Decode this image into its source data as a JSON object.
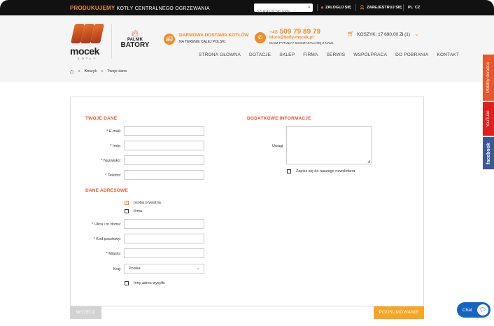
{
  "topbar": {
    "promo_highlight": "PRODUKUJEMY",
    "promo_text": "KOTŁY CENTRALNEGO OGRZEWANIA",
    "search_placeholder": "SZUKAJ W SKLEPIE...",
    "login": "ZALOGUJ SIĘ",
    "register": "ZAREJESTRUJ SIĘ",
    "lang_pl": "PL",
    "lang_cz": "CZ"
  },
  "header": {
    "logo_name": "mocek",
    "logo_sub": "KOTŁY",
    "partner_small": "PALNIK",
    "partner_big": "BATORY",
    "delivery_title": "DARMOWA DOSTAWA KOTŁÓW",
    "delivery_sub": "NA TERENIE CAŁEJ POLSKI.",
    "phone_prefix": "+48",
    "phone": "509 79 89 79",
    "email": "biuro@kotly-mocek.pl",
    "ask": "MASZ PYTANIA? SKONTAKTUJ SIĘ Z NAMI.",
    "cart": "KOSZYK: 17 690,00 Zł (1)"
  },
  "nav": [
    "STRONA GŁÓWNA",
    "DOTACJE",
    "SKLEP",
    "FIRMA",
    "SERWIS",
    "WSPÓŁPRACA",
    "DO POBRANIA",
    "KONTAKT"
  ],
  "breadcrumb": {
    "sep": "»",
    "items": [
      "Koszyk",
      "Twoje dane"
    ]
  },
  "form": {
    "your_data_title": "TWOJE DANE",
    "email_label": "* E-mail:",
    "name_label": "* Imię:",
    "surname_label": "* Nazwisko:",
    "phone_label": "* Telefon:",
    "address_title": "DANE ADRESOWE",
    "private_label": "osoba prywatna",
    "company_label": "firma",
    "street_label": "* Ulica i nr domu:",
    "zip_label": "* Kod pocztowy:",
    "city_label": "* Miasto:",
    "country_label": "Kraj:",
    "country_value": "Polska",
    "other_address_label": "Inny adres wysyłki",
    "extra_title": "DODATKOWE INFORMACJE",
    "notes_label": "Uwagi",
    "newsletter_label": "Zapisz się do naszego newslettera",
    "back_button": "WSTECZ",
    "next_button": "PODSUMOWANIE"
  },
  "side": {
    "mobile": "Mobilny doradca",
    "youtube": "YouTube",
    "facebook": "facebook"
  },
  "chat": {
    "label": "Chat"
  },
  "colors": {
    "accent": "#f28c28",
    "title": "#e8562a"
  }
}
